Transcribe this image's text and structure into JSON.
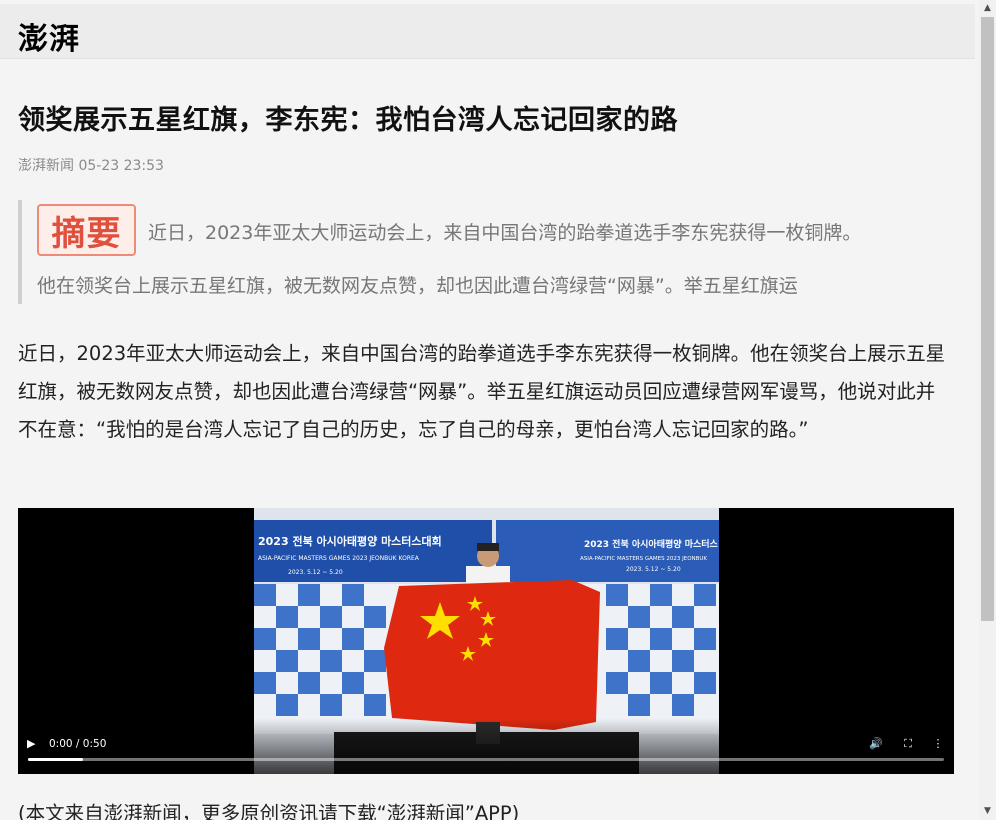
{
  "header": {
    "logo_text": "澎湃"
  },
  "article": {
    "title": "领奖展示五星红旗，李东宪：我怕台湾人忘记回家的路",
    "meta": "澎湃新闻 05-23 23:53",
    "summary": {
      "badge": "摘要",
      "line1": "近日，2023年亚太大师运动会上，来自中国台湾的跆拳道选手李东宪获得一枚铜牌。",
      "line2": "他在领奖台上展示五星红旗，被无数网友点赞，却也因此遭台湾绿营“网暴”。举五星红旗运"
    },
    "body": "近日，2023年亚太大师运动会上，来自中国台湾的跆拳道选手李东宪获得一枚铜牌。他在领奖台上展示五星红旗，被无数网友点赞，却也因此遭台湾绿营“网暴”。举五星红旗运动员回应遭绿营网军谩骂，他说对此并不在意：“我怕的是台湾人忘记了自己的历史，忘了自己的母亲，更怕台湾人忘记回家的路。”",
    "footer_note": "(本文来自澎湃新闻，更多原创资讯请下载“澎湃新闻”APP)"
  },
  "video": {
    "time": "0:00 / 0:50",
    "progress": 0.06,
    "backdrop": {
      "banner_left": "2023 전북 아시아태평양 마스터스대회",
      "banner_left_sub": "ASIA-PACIFIC MASTERS GAMES 2023 JEONBUK KOREA",
      "banner_right": "2023 전북 아시아태평양 마스터스",
      "banner_right_sub": "ASIA-PACIFIC MASTERS GAMES 2023 JEONBUK",
      "dates": "2023. 5.12 ~ 5.20"
    },
    "icons": {
      "play": "play-icon",
      "volume": "volume-icon",
      "fullscreen": "fullscreen-icon",
      "more": "more-vertical-icon"
    }
  },
  "colors": {
    "page_bg": "#f4f4f4",
    "header_bg": "#ececec",
    "summary_badge": "#e0503c",
    "flag_red": "#de2910",
    "flag_star": "#ffde00",
    "banner_blue": "#1f4fa8"
  }
}
